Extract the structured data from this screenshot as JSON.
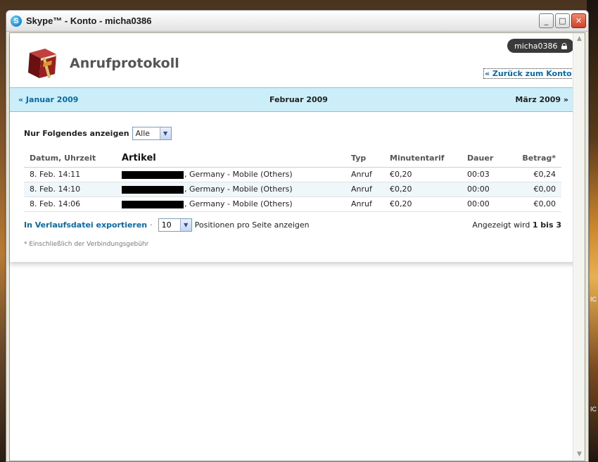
{
  "window": {
    "title": "Skype™ - Konto - micha0386",
    "app_icon": "S",
    "minimize_glyph": "_",
    "maximize_glyph": "□",
    "close_glyph": "✕"
  },
  "header": {
    "page_title": "Anrufprotokoll",
    "user": "micha0386",
    "back_link": "« Zurück zum Konto"
  },
  "month_nav": {
    "previous": "« Januar 2009",
    "current": "Februar 2009",
    "next": "März 2009 »"
  },
  "filter": {
    "label": "Nur Folgendes anzeigen",
    "selected": "Alle"
  },
  "table": {
    "columns": [
      "Datum, Uhrzeit",
      "Artikel",
      "Typ",
      "Minutentarif",
      "Dauer",
      "Betrag*"
    ],
    "rows": [
      {
        "datetime": "8. Feb. 14:11",
        "article": ", Germany - Mobile (Others)",
        "type": "Anruf",
        "rate": "€0,20",
        "duration": "00:03",
        "amount": "€0,24"
      },
      {
        "datetime": "8. Feb. 14:10",
        "article": ", Germany - Mobile (Others)",
        "type": "Anruf",
        "rate": "€0,20",
        "duration": "00:00",
        "amount": "€0,00"
      },
      {
        "datetime": "8. Feb. 14:06",
        "article": ", Germany - Mobile (Others)",
        "type": "Anruf",
        "rate": "€0,20",
        "duration": "00:00",
        "amount": "€0,00"
      }
    ]
  },
  "footer": {
    "export_link": "In Verlaufsdatei exportieren",
    "separator": "·",
    "per_page": "10",
    "per_page_label": "Positionen pro Seite anzeigen",
    "shown_prefix": "Angezeigt wird",
    "shown_range": "1 bis 3",
    "footnote": "* Einschließlich der Verbindungsgebühr"
  },
  "desktop": {
    "glyph_1": "IC",
    "glyph_2": "IC"
  },
  "colors": {
    "link": "#0a6aa8",
    "nav_band": "#cbeef9",
    "book_red": "#8a1a1a"
  },
  "icons": {
    "app": "skype-icon",
    "page": "book-icon",
    "lock": "lock-icon"
  }
}
